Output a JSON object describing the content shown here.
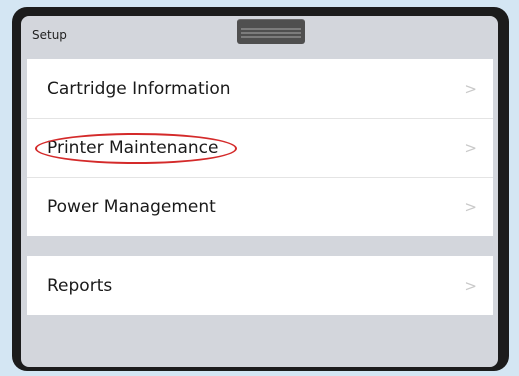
{
  "header": {
    "title": "Setup"
  },
  "menu": {
    "group1": [
      {
        "label": "Cartridge Information",
        "chevron": ">"
      },
      {
        "label": "Printer Maintenance",
        "chevron": ">"
      },
      {
        "label": "Power Management",
        "chevron": ">"
      }
    ],
    "group2": [
      {
        "label": "Reports",
        "chevron": ">"
      }
    ]
  },
  "annotation": {
    "color": "#d42a2a",
    "target": "Printer Maintenance"
  }
}
